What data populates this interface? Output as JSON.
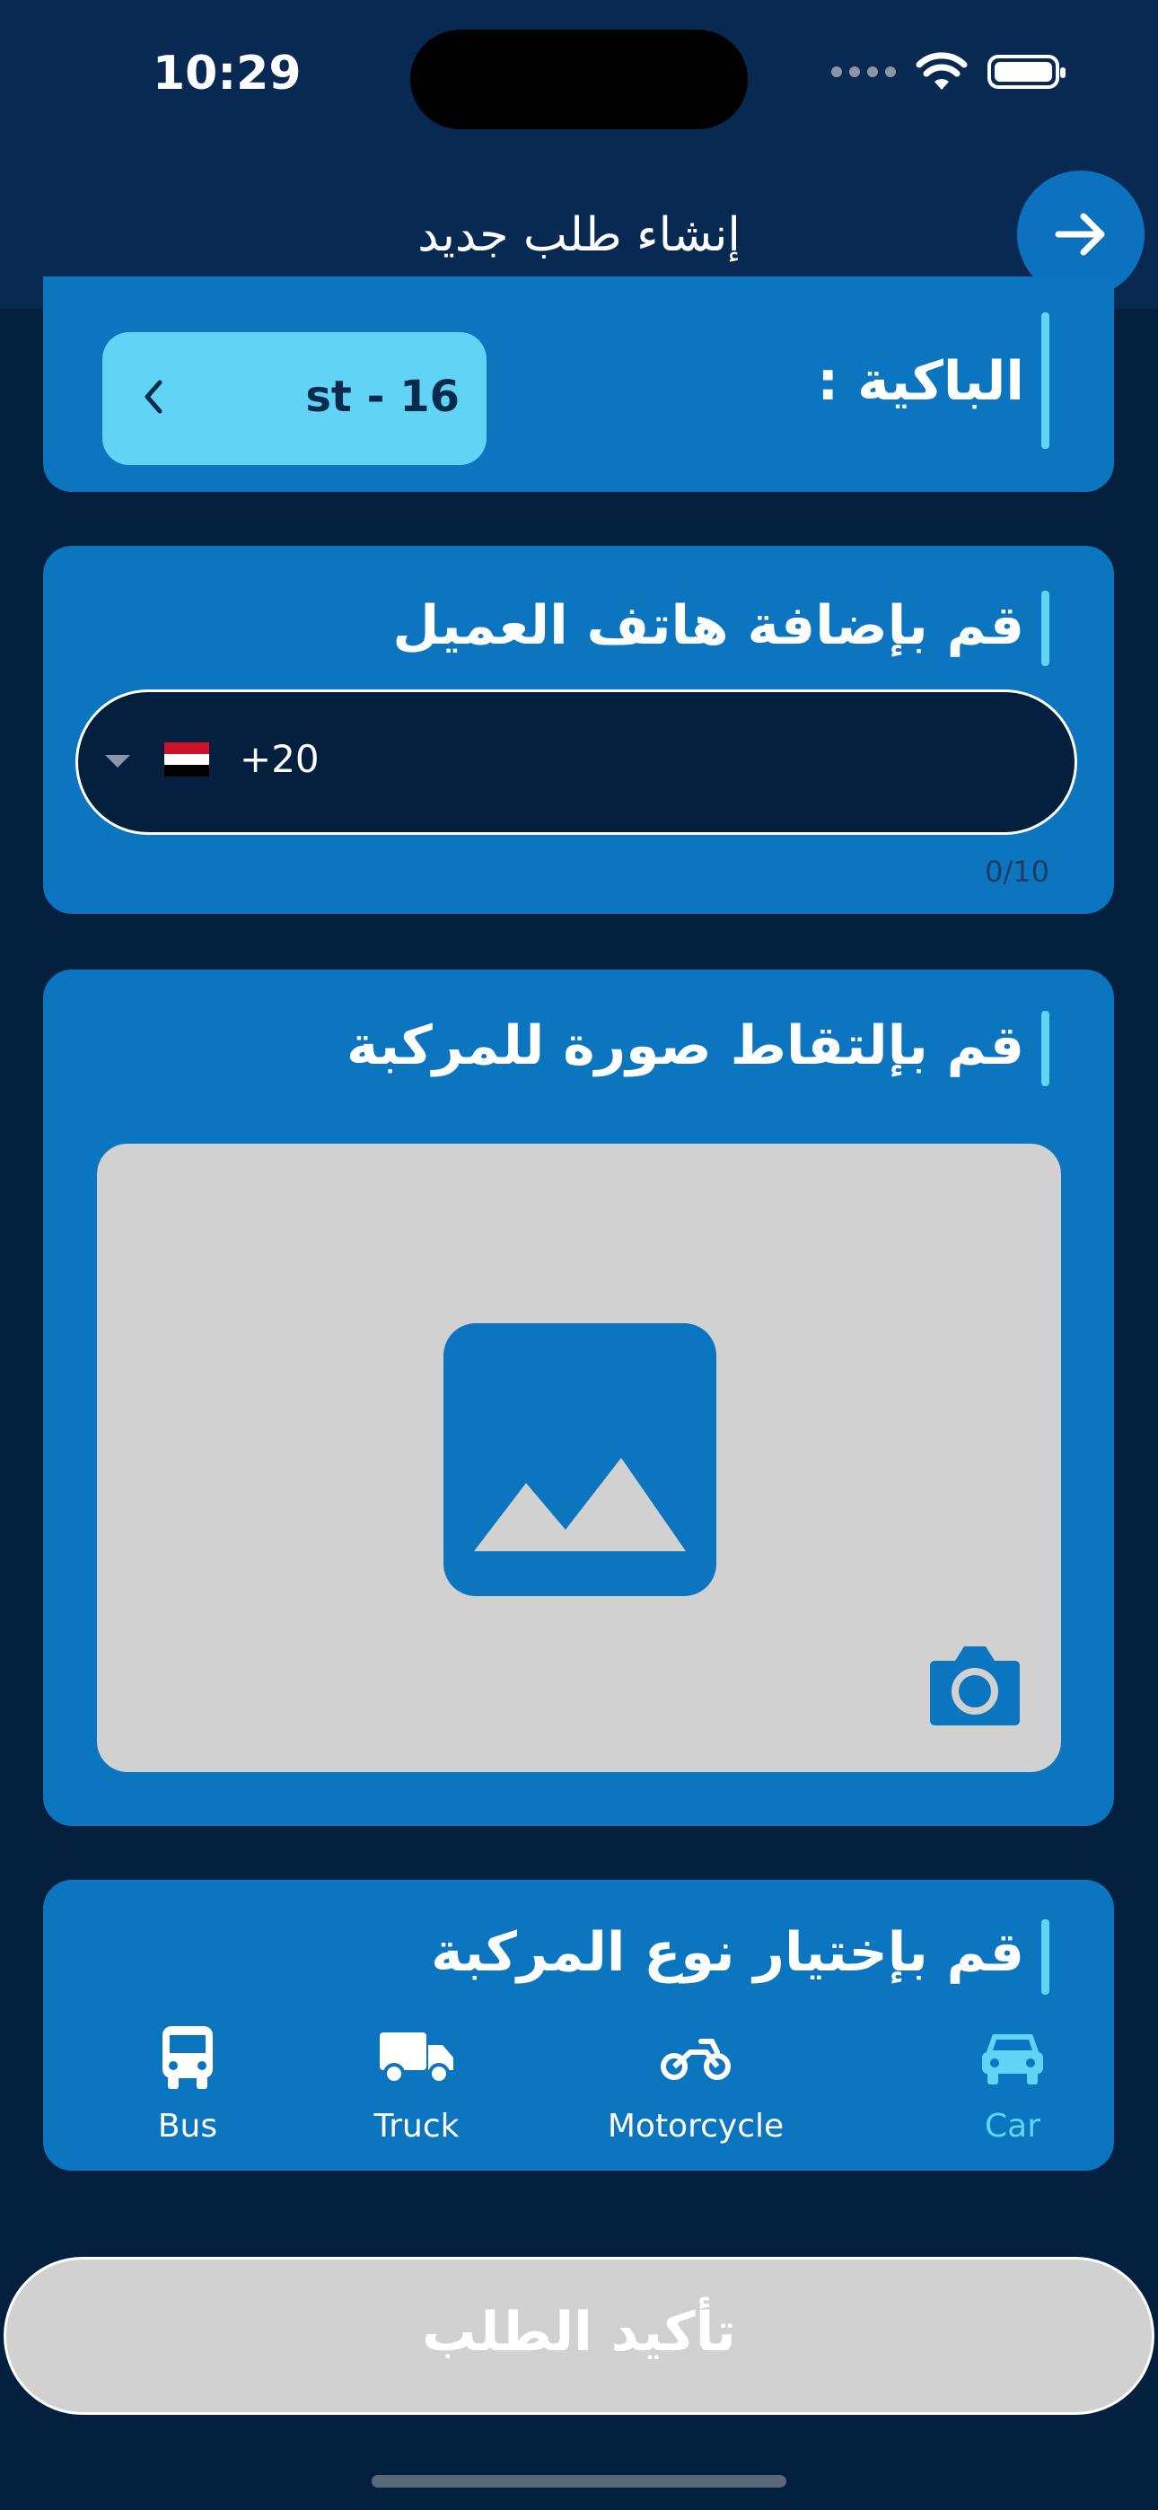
{
  "status_bar": {
    "time": "10:29"
  },
  "header": {
    "title": "إنشاء طلب جديد",
    "back_icon": "arrow-right-icon"
  },
  "plate": {
    "label": "الباكية :",
    "value": "st - 16",
    "chevron_icon": "chevron-left-icon"
  },
  "phone": {
    "title": "قم بإضافة هاتف العميل",
    "country_code": "+20",
    "flag": "egypt-flag",
    "counter": "0/10"
  },
  "photo": {
    "title": "قم بإلتقاط صورة للمركبة",
    "placeholder_icon": "image-placeholder-icon",
    "camera_icon": "camera-icon"
  },
  "vehicle": {
    "title": "قم بإختيار نوع المركبة",
    "types": [
      {
        "label": "Bus",
        "icon": "bus-icon",
        "selected": false
      },
      {
        "label": "Truck",
        "icon": "truck-icon",
        "selected": false
      },
      {
        "label": "Motorcycle",
        "icon": "motorcycle-icon",
        "selected": false
      },
      {
        "label": "Car",
        "icon": "car-icon",
        "selected": true
      }
    ]
  },
  "confirm": {
    "label": "تأكيد الطلب"
  },
  "colors": {
    "background": "#03203f",
    "header": "#082a52",
    "card": "#0b75c0",
    "accent": "#61d4f6",
    "disabled_button": "#d1d1d1"
  }
}
